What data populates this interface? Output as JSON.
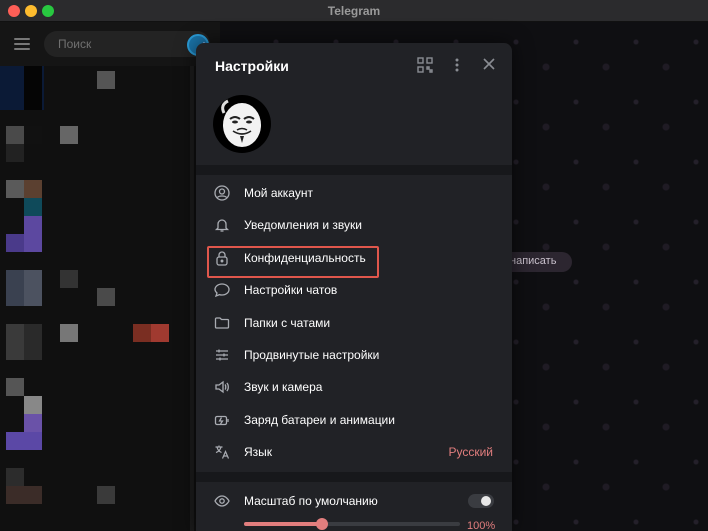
{
  "window": {
    "title": "Telegram"
  },
  "search": {
    "placeholder": "Поиск"
  },
  "background": {
    "write_button": "написать"
  },
  "settings": {
    "title": "Настройки",
    "menu": [
      {
        "label": "Мой аккаунт",
        "icon": "account-icon"
      },
      {
        "label": "Уведомления и звуки",
        "icon": "bell-icon"
      },
      {
        "label": "Конфиденциальность",
        "icon": "lock-icon",
        "highlighted": true
      },
      {
        "label": "Настройки чатов",
        "icon": "chat-bubble-icon"
      },
      {
        "label": "Папки с чатами",
        "icon": "folder-icon"
      },
      {
        "label": "Продвинутые настройки",
        "icon": "sliders-icon"
      },
      {
        "label": "Звук и камера",
        "icon": "speaker-icon"
      },
      {
        "label": "Заряд батареи и анимации",
        "icon": "battery-icon"
      },
      {
        "label": "Язык",
        "icon": "translate-icon",
        "value": "Русский"
      }
    ],
    "scale": {
      "label": "Масштаб по умолчанию",
      "toggle_on": false,
      "value_text": "100%",
      "slider_fraction": 0.36
    }
  },
  "colors": {
    "accent": "#e27e7e",
    "highlight_border": "#e0574c",
    "modal_bg": "#212226"
  }
}
